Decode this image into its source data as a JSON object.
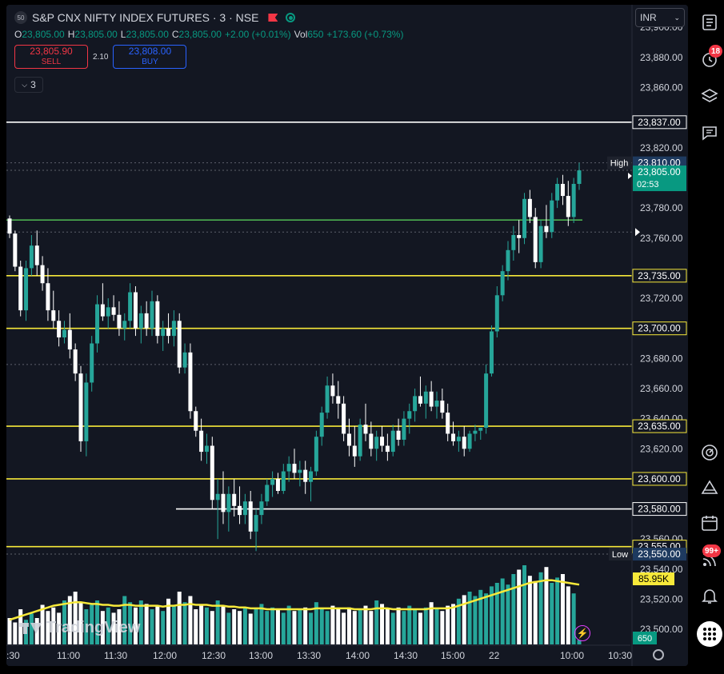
{
  "header": {
    "exchange_badge": "50",
    "symbol": "S&P CNX NIFTY INDEX FUTURES · 3 · NSE",
    "ohlc": [
      {
        "k": "O",
        "v": "23,805.00"
      },
      {
        "k": "H",
        "v": "23,805.00"
      },
      {
        "k": "L",
        "v": "23,805.00"
      },
      {
        "k": "C",
        "v": "23,805.00"
      },
      {
        "k": "",
        "v": "+2.00 (+0.01%)"
      },
      {
        "k": "Vol",
        "v": "650"
      },
      {
        "k": "",
        "v": "+173.60 (+0.73%)"
      }
    ]
  },
  "trade": {
    "sell_price": "23,805.90",
    "sell_label": "SELL",
    "spread": "2.10",
    "buy_price": "23,808.00",
    "buy_label": "BUY"
  },
  "indicator_toggle": {
    "count": "3"
  },
  "currency": "INR",
  "watermark": "TradingView",
  "colors": {
    "bg": "#131722",
    "up": "#26a69a",
    "down": "#ffffff",
    "level": "#f7e93a",
    "ma": "#f7e93a",
    "green_line": "#4caf50",
    "accent": "#2962ff"
  },
  "icons": {
    "sidebar": [
      "list-icon",
      "alarm-clock-icon",
      "layers-icon",
      "chat-icon",
      "compass-icon",
      "triangle-icon",
      "calendar-icon",
      "broadcast-icon",
      "bell-icon",
      "grid-icon"
    ],
    "sidebar_badges": {
      "alarm": "18",
      "broadcast": "99+"
    }
  },
  "chart_data": {
    "type": "candlestick",
    "ylim": [
      23490,
      23915
    ],
    "y_ticks": [
      "23,900.00",
      "23,880.00",
      "23,860.00",
      "23,820.00",
      "23,780.00",
      "23,760.00",
      "23,720.00",
      "23,680.00",
      "23,660.00",
      "23,640.00",
      "23,620.00",
      "23,560.00",
      "23,540.00",
      "23,520.00",
      "23,500.00"
    ],
    "x_ticks": [
      ":30",
      "11:00",
      "11:30",
      "12:00",
      "12:30",
      "13:00",
      "13:30",
      "14:00",
      "14:30",
      "15:00",
      "22",
      "10:00",
      "10:30"
    ],
    "horizontal_levels": [
      {
        "value": 23837,
        "color": "#ffffff",
        "label": "23,837.00"
      },
      {
        "value": 23735,
        "color": "#f7e93a",
        "label": "23,735.00"
      },
      {
        "value": 23700,
        "color": "#f7e93a",
        "label": "23,700.00"
      },
      {
        "value": 23635,
        "color": "#f7e93a",
        "label": "23,635.00"
      },
      {
        "value": 23600,
        "color": "#f7e93a",
        "label": "23,600.00"
      },
      {
        "value": 23580,
        "color": "#ffffff",
        "label": "23,580.00"
      },
      {
        "value": 23555,
        "color": "#f7e93a",
        "label": "23,555.00"
      }
    ],
    "green_level": 23772,
    "price_labels": {
      "high_tag": "High",
      "high_value": "23,810.00",
      "last_value": "23,805.00",
      "countdown": "02:53",
      "low_tag": "Low",
      "low_value": "23,550.00",
      "ma_volume": "85.95K",
      "last_volume": "650"
    },
    "high": 23810,
    "low": 23550,
    "last": 23805,
    "candles": [
      {
        "o": 23773,
        "h": 23775,
        "l": 23760,
        "c": 23763
      },
      {
        "o": 23763,
        "h": 23765,
        "l": 23738,
        "c": 23741
      },
      {
        "o": 23741,
        "h": 23745,
        "l": 23708,
        "c": 23712
      },
      {
        "o": 23712,
        "h": 23745,
        "l": 23705,
        "c": 23740
      },
      {
        "o": 23740,
        "h": 23762,
        "l": 23735,
        "c": 23755
      },
      {
        "o": 23755,
        "h": 23765,
        "l": 23735,
        "c": 23742
      },
      {
        "o": 23742,
        "h": 23748,
        "l": 23725,
        "c": 23730
      },
      {
        "o": 23730,
        "h": 23740,
        "l": 23705,
        "c": 23712
      },
      {
        "o": 23712,
        "h": 23725,
        "l": 23700,
        "c": 23705
      },
      {
        "o": 23705,
        "h": 23712,
        "l": 23688,
        "c": 23694
      },
      {
        "o": 23694,
        "h": 23705,
        "l": 23690,
        "c": 23699
      },
      {
        "o": 23699,
        "h": 23710,
        "l": 23680,
        "c": 23686
      },
      {
        "o": 23686,
        "h": 23690,
        "l": 23665,
        "c": 23670
      },
      {
        "o": 23670,
        "h": 23675,
        "l": 23618,
        "c": 23625
      },
      {
        "o": 23625,
        "h": 23670,
        "l": 23615,
        "c": 23664
      },
      {
        "o": 23664,
        "h": 23695,
        "l": 23658,
        "c": 23690
      },
      {
        "o": 23690,
        "h": 23722,
        "l": 23684,
        "c": 23716
      },
      {
        "o": 23716,
        "h": 23730,
        "l": 23705,
        "c": 23708
      },
      {
        "o": 23708,
        "h": 23720,
        "l": 23700,
        "c": 23714
      },
      {
        "o": 23714,
        "h": 23722,
        "l": 23705,
        "c": 23709
      },
      {
        "o": 23709,
        "h": 23718,
        "l": 23695,
        "c": 23700
      },
      {
        "o": 23700,
        "h": 23710,
        "l": 23692,
        "c": 23705
      },
      {
        "o": 23705,
        "h": 23730,
        "l": 23700,
        "c": 23724
      },
      {
        "o": 23724,
        "h": 23728,
        "l": 23695,
        "c": 23700
      },
      {
        "o": 23700,
        "h": 23715,
        "l": 23690,
        "c": 23710
      },
      {
        "o": 23710,
        "h": 23718,
        "l": 23695,
        "c": 23700
      },
      {
        "o": 23700,
        "h": 23725,
        "l": 23695,
        "c": 23718
      },
      {
        "o": 23718,
        "h": 23722,
        "l": 23690,
        "c": 23695
      },
      {
        "o": 23695,
        "h": 23705,
        "l": 23685,
        "c": 23700
      },
      {
        "o": 23700,
        "h": 23710,
        "l": 23690,
        "c": 23695
      },
      {
        "o": 23695,
        "h": 23712,
        "l": 23688,
        "c": 23705
      },
      {
        "o": 23705,
        "h": 23710,
        "l": 23670,
        "c": 23674
      },
      {
        "o": 23674,
        "h": 23690,
        "l": 23670,
        "c": 23684
      },
      {
        "o": 23684,
        "h": 23690,
        "l": 23640,
        "c": 23645
      },
      {
        "o": 23645,
        "h": 23648,
        "l": 23628,
        "c": 23632
      },
      {
        "o": 23632,
        "h": 23640,
        "l": 23612,
        "c": 23618
      },
      {
        "o": 23618,
        "h": 23630,
        "l": 23610,
        "c": 23622
      },
      {
        "o": 23622,
        "h": 23628,
        "l": 23580,
        "c": 23586
      },
      {
        "o": 23586,
        "h": 23600,
        "l": 23560,
        "c": 23590
      },
      {
        "o": 23590,
        "h": 23605,
        "l": 23570,
        "c": 23578
      },
      {
        "o": 23578,
        "h": 23595,
        "l": 23565,
        "c": 23590
      },
      {
        "o": 23590,
        "h": 23600,
        "l": 23575,
        "c": 23582
      },
      {
        "o": 23582,
        "h": 23595,
        "l": 23570,
        "c": 23576
      },
      {
        "o": 23576,
        "h": 23590,
        "l": 23570,
        "c": 23585
      },
      {
        "o": 23585,
        "h": 23592,
        "l": 23560,
        "c": 23565
      },
      {
        "o": 23565,
        "h": 23580,
        "l": 23552,
        "c": 23576
      },
      {
        "o": 23576,
        "h": 23590,
        "l": 23570,
        "c": 23585
      },
      {
        "o": 23585,
        "h": 23600,
        "l": 23582,
        "c": 23596
      },
      {
        "o": 23596,
        "h": 23605,
        "l": 23588,
        "c": 23600
      },
      {
        "o": 23600,
        "h": 23604,
        "l": 23590,
        "c": 23592
      },
      {
        "o": 23592,
        "h": 23610,
        "l": 23590,
        "c": 23605
      },
      {
        "o": 23605,
        "h": 23615,
        "l": 23598,
        "c": 23610
      },
      {
        "o": 23610,
        "h": 23620,
        "l": 23600,
        "c": 23604
      },
      {
        "o": 23604,
        "h": 23612,
        "l": 23595,
        "c": 23606
      },
      {
        "o": 23606,
        "h": 23612,
        "l": 23590,
        "c": 23598
      },
      {
        "o": 23598,
        "h": 23608,
        "l": 23585,
        "c": 23605
      },
      {
        "o": 23605,
        "h": 23632,
        "l": 23602,
        "c": 23628
      },
      {
        "o": 23628,
        "h": 23648,
        "l": 23622,
        "c": 23644
      },
      {
        "o": 23644,
        "h": 23668,
        "l": 23640,
        "c": 23662
      },
      {
        "o": 23662,
        "h": 23670,
        "l": 23650,
        "c": 23655
      },
      {
        "o": 23655,
        "h": 23665,
        "l": 23640,
        "c": 23650
      },
      {
        "o": 23650,
        "h": 23655,
        "l": 23625,
        "c": 23630
      },
      {
        "o": 23630,
        "h": 23640,
        "l": 23615,
        "c": 23622
      },
      {
        "o": 23622,
        "h": 23635,
        "l": 23608,
        "c": 23615
      },
      {
        "o": 23615,
        "h": 23640,
        "l": 23612,
        "c": 23636
      },
      {
        "o": 23636,
        "h": 23650,
        "l": 23625,
        "c": 23630
      },
      {
        "o": 23630,
        "h": 23638,
        "l": 23615,
        "c": 23620
      },
      {
        "o": 23620,
        "h": 23632,
        "l": 23612,
        "c": 23628
      },
      {
        "o": 23628,
        "h": 23635,
        "l": 23618,
        "c": 23622
      },
      {
        "o": 23622,
        "h": 23630,
        "l": 23612,
        "c": 23618
      },
      {
        "o": 23618,
        "h": 23636,
        "l": 23615,
        "c": 23632
      },
      {
        "o": 23632,
        "h": 23640,
        "l": 23622,
        "c": 23626
      },
      {
        "o": 23626,
        "h": 23645,
        "l": 23622,
        "c": 23640
      },
      {
        "o": 23640,
        "h": 23650,
        "l": 23630,
        "c": 23645
      },
      {
        "o": 23645,
        "h": 23660,
        "l": 23638,
        "c": 23655
      },
      {
        "o": 23655,
        "h": 23668,
        "l": 23648,
        "c": 23650
      },
      {
        "o": 23650,
        "h": 23662,
        "l": 23640,
        "c": 23658
      },
      {
        "o": 23658,
        "h": 23665,
        "l": 23645,
        "c": 23648
      },
      {
        "o": 23648,
        "h": 23658,
        "l": 23640,
        "c": 23652
      },
      {
        "o": 23652,
        "h": 23660,
        "l": 23640,
        "c": 23644
      },
      {
        "o": 23644,
        "h": 23650,
        "l": 23625,
        "c": 23630
      },
      {
        "o": 23630,
        "h": 23638,
        "l": 23622,
        "c": 23625
      },
      {
        "o": 23625,
        "h": 23632,
        "l": 23618,
        "c": 23628
      },
      {
        "o": 23628,
        "h": 23635,
        "l": 23615,
        "c": 23620
      },
      {
        "o": 23620,
        "h": 23632,
        "l": 23618,
        "c": 23630
      },
      {
        "o": 23630,
        "h": 23636,
        "l": 23625,
        "c": 23632
      },
      {
        "o": 23632,
        "h": 23634,
        "l": 23626,
        "c": 23634
      },
      {
        "o": 23634,
        "h": 23676,
        "l": 23630,
        "c": 23670
      },
      {
        "o": 23670,
        "h": 23702,
        "l": 23668,
        "c": 23698
      },
      {
        "o": 23698,
        "h": 23728,
        "l": 23694,
        "c": 23722
      },
      {
        "o": 23722,
        "h": 23742,
        "l": 23718,
        "c": 23738
      },
      {
        "o": 23738,
        "h": 23758,
        "l": 23732,
        "c": 23752
      },
      {
        "o": 23752,
        "h": 23768,
        "l": 23745,
        "c": 23762
      },
      {
        "o": 23762,
        "h": 23772,
        "l": 23750,
        "c": 23760
      },
      {
        "o": 23760,
        "h": 23790,
        "l": 23756,
        "c": 23786
      },
      {
        "o": 23786,
        "h": 23792,
        "l": 23770,
        "c": 23774
      },
      {
        "o": 23774,
        "h": 23780,
        "l": 23740,
        "c": 23744
      },
      {
        "o": 23744,
        "h": 23772,
        "l": 23740,
        "c": 23768
      },
      {
        "o": 23768,
        "h": 23782,
        "l": 23760,
        "c": 23764
      },
      {
        "o": 23764,
        "h": 23790,
        "l": 23760,
        "c": 23785
      },
      {
        "o": 23785,
        "h": 23800,
        "l": 23780,
        "c": 23796
      },
      {
        "o": 23796,
        "h": 23802,
        "l": 23782,
        "c": 23788
      },
      {
        "o": 23788,
        "h": 23798,
        "l": 23768,
        "c": 23774
      },
      {
        "o": 23774,
        "h": 23800,
        "l": 23770,
        "c": 23796
      },
      {
        "o": 23796,
        "h": 23810,
        "l": 23792,
        "c": 23805
      }
    ],
    "volumes": [
      30,
      25,
      40,
      28,
      35,
      30,
      45,
      38,
      42,
      36,
      50,
      55,
      60,
      48,
      40,
      45,
      50,
      38,
      42,
      36,
      40,
      55,
      48,
      42,
      50,
      46,
      40,
      44,
      38,
      52,
      45,
      60,
      48,
      55,
      40,
      45,
      42,
      38,
      50,
      44,
      36,
      40,
      38,
      42,
      35,
      40,
      46,
      38,
      42,
      40,
      36,
      44,
      38,
      40,
      42,
      36,
      48,
      40,
      38,
      44,
      40,
      36,
      42,
      38,
      40,
      44,
      38,
      50,
      46,
      40,
      36,
      42,
      38,
      44,
      40,
      36,
      42,
      48,
      40,
      38,
      44,
      46,
      52,
      56,
      60,
      55,
      62,
      58,
      66,
      70,
      75,
      68,
      80,
      85,
      90,
      78,
      72,
      82,
      88,
      70,
      76,
      80,
      66,
      58,
      5
    ],
    "volume_ma": [
      28,
      30,
      32,
      34,
      36,
      38,
      40,
      42,
      44,
      45,
      46,
      47,
      48,
      48,
      47,
      46,
      46,
      45,
      45,
      44,
      44,
      45,
      45,
      44,
      44,
      44,
      44,
      44,
      43,
      44,
      44,
      45,
      45,
      46,
      45,
      45,
      45,
      44,
      44,
      44,
      43,
      43,
      42,
      42,
      41,
      41,
      41,
      40,
      40,
      40,
      40,
      40,
      40,
      40,
      40,
      40,
      41,
      41,
      41,
      41,
      41,
      41,
      41,
      40,
      40,
      40,
      40,
      41,
      41,
      41,
      40,
      40,
      40,
      40,
      40,
      40,
      40,
      41,
      41,
      41,
      41,
      42,
      44,
      46,
      48,
      50,
      52,
      54,
      56,
      58,
      60,
      62,
      64,
      66,
      68,
      70,
      71,
      72,
      73,
      73,
      72,
      71,
      70,
      69,
      68
    ]
  }
}
